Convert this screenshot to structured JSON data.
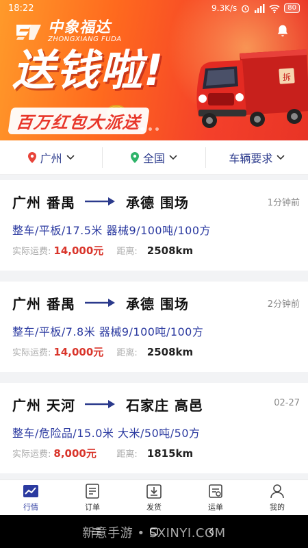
{
  "status_bar": {
    "time": "18:22",
    "net_speed": "9.3K/s",
    "battery": "80"
  },
  "banner": {
    "brand_cn": "中象福达",
    "brand_en": "ZHONGXIANG FUDA",
    "headline": "送钱啦!",
    "subline": "百万红包大派送",
    "colors": {
      "accent": "#f4402a",
      "highlight": "#ff9a2a"
    }
  },
  "filters": {
    "origin": "广州",
    "destination": "全国",
    "vehicle": "车辆要求"
  },
  "orders": [
    {
      "from": "广州 番禺",
      "to": "承德 围场",
      "time": "1分钟前",
      "spec": "整车/平板/17.5米  器械9/100吨/100方",
      "fee_label": "实际运费:",
      "fee": "14,000元",
      "dist_label": "距离:",
      "dist": "2508km"
    },
    {
      "from": "广州 番禺",
      "to": "承德 围场",
      "time": "2分钟前",
      "spec": "整车/平板/7.8米  器械9/100吨/100方",
      "fee_label": "实际运费:",
      "fee": "14,000元",
      "dist_label": "距离:",
      "dist": "2508km"
    },
    {
      "from": "广州 天河",
      "to": "石家庄 高邑",
      "time": "02-27",
      "spec": "整车/危险品/15.0米  大米/50吨/50方",
      "fee_label": "实际运费:",
      "fee": "8,000元",
      "dist_label": "距离:",
      "dist": "1815km"
    }
  ],
  "tabs": [
    {
      "label": "行情",
      "icon": "chart-icon",
      "active": true
    },
    {
      "label": "订单",
      "icon": "document-icon"
    },
    {
      "label": "发货",
      "icon": "download-box-icon"
    },
    {
      "label": "运单",
      "icon": "waybill-icon"
    },
    {
      "label": "我的",
      "icon": "person-icon"
    }
  ],
  "watermark": "新意手游 • SXINYI.COM",
  "colors": {
    "brand": "#2b3aa0",
    "price": "#d9352b"
  }
}
